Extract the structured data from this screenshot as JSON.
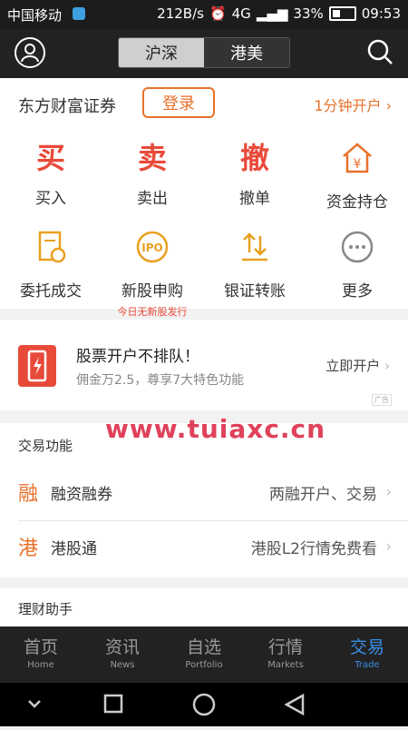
{
  "status_bar": {
    "carrier": "中国移动",
    "speed": "212B/s",
    "network": "4G",
    "battery": "33%",
    "time": "09:53"
  },
  "header": {
    "tabs": [
      {
        "label": "沪深",
        "active": true
      },
      {
        "label": "港美",
        "active": false
      }
    ]
  },
  "account": {
    "broker": "东方财富证券",
    "login_label": "登录",
    "open_account": "1分钟开户"
  },
  "grid": {
    "row1": [
      {
        "glyph": "买",
        "label": "买入"
      },
      {
        "glyph": "卖",
        "label": "卖出"
      },
      {
        "glyph": "撤",
        "label": "撤单"
      },
      {
        "glyph": "¥",
        "label": "资金持仓"
      }
    ],
    "row2": [
      {
        "label": "委托成交"
      },
      {
        "label": "新股申购",
        "sub": "今日无新股发行",
        "glyph": "IPO"
      },
      {
        "label": "银证转账"
      },
      {
        "label": "更多"
      }
    ]
  },
  "banner": {
    "title": "股票开户不排队！",
    "subtitle": "佣金万2.5，尊享7大特色功能",
    "cta": "立即开户",
    "ad": "广告"
  },
  "watermark": "www.tuiaxc.cn",
  "trade_functions": {
    "title": "交易功能",
    "items": [
      {
        "icon_glyph": "融",
        "label": "融资融券",
        "detail": "两融开户、交易"
      },
      {
        "icon_glyph": "港",
        "label": "港股通",
        "detail": "港股L2行情免费看"
      }
    ]
  },
  "finance": {
    "title": "理财助手"
  },
  "tabs": [
    {
      "cn": "首页",
      "en": "Home",
      "active": false
    },
    {
      "cn": "资讯",
      "en": "News",
      "active": false
    },
    {
      "cn": "自选",
      "en": "Portfolio",
      "active": false
    },
    {
      "cn": "行情",
      "en": "Markets",
      "active": false
    },
    {
      "cn": "交易",
      "en": "Trade",
      "active": true
    }
  ],
  "colors": {
    "accent": "#e8712a",
    "red": "#e84a3a",
    "active_tab": "#3a8ee6"
  }
}
